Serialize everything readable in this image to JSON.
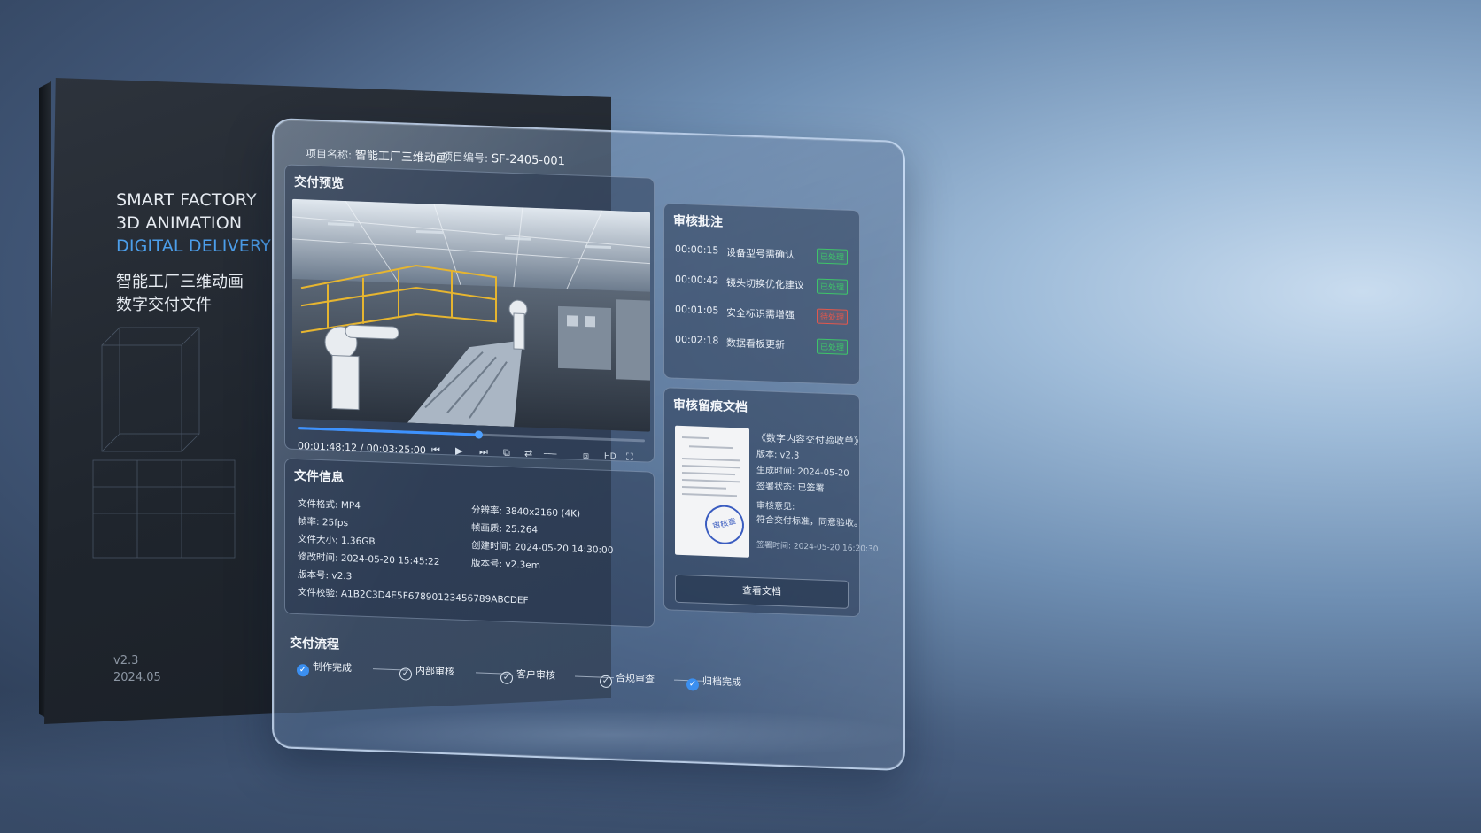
{
  "box": {
    "title_lines": [
      "SMART FACTORY",
      "3D ANIMATION",
      "DIGITAL DELIVERY"
    ],
    "cn_lines": [
      "智能工厂三维动画",
      "数字交付文件"
    ],
    "version": "v2.3",
    "date": "2024.05"
  },
  "header": {
    "project_name_label": "项目名称:",
    "project_name": "智能工厂三维动画",
    "project_no_label": "项目编号:",
    "project_no": "SF-2405-001"
  },
  "preview": {
    "title": "交付预览",
    "time": "00:01:48:12 / 00:03:25:00",
    "progress": 0.52,
    "controls": [
      "⏮",
      "▶",
      "⏭",
      "⧉",
      "⇄",
      "───",
      "⧈",
      "HD",
      "⛶"
    ]
  },
  "review": {
    "title": "审核批注",
    "items": [
      {
        "time": "00:00:15",
        "text": "设备型号需确认",
        "status": "已处理",
        "color": "#3fc46a"
      },
      {
        "time": "00:00:42",
        "text": "镜头切换优化建议",
        "status": "已处理",
        "color": "#3fc46a"
      },
      {
        "time": "00:01:05",
        "text": "安全标识需增强",
        "status": "待处理",
        "color": "#e0584d"
      },
      {
        "time": "00:02:18",
        "text": "数据看板更新",
        "status": "已处理",
        "color": "#3fc46a"
      }
    ]
  },
  "doc": {
    "title": "审核留痕文档",
    "name": "《数字内容交付验收单》",
    "version": "版本: v2.3",
    "generated": "生成时间: 2024-05-20",
    "sign_status": "签署状态: 已签署",
    "opinion_label": "审核意见:",
    "opinion": "符合交付标准，同意验收。",
    "signed_time": "签署时间: 2024-05-20 16:20:30",
    "stamp": "审核章",
    "button": "查看文档"
  },
  "file": {
    "title": "文件信息",
    "left": [
      "文件格式: MP4",
      "帧率: 25fps",
      "文件大小: 1.36GB",
      "修改时间: 2024-05-20 15:45:22",
      "版本号: v2.3",
      "文件校验: A1B2C3D4E5F67890123456789ABCDEF"
    ],
    "right": [
      "分辨率: 3840x2160 (4K)",
      "帧画质: 25.264",
      "创建时间: 2024-05-20 14:30:00",
      "版本号: v2.3em"
    ]
  },
  "flow": {
    "title": "交付流程",
    "steps": [
      {
        "label": "制作完成",
        "state": "done"
      },
      {
        "label": "内部审核",
        "state": "open"
      },
      {
        "label": "客户审核",
        "state": "open"
      },
      {
        "label": "合规审查",
        "state": "open"
      },
      {
        "label": "归档完成",
        "state": "done"
      }
    ]
  }
}
